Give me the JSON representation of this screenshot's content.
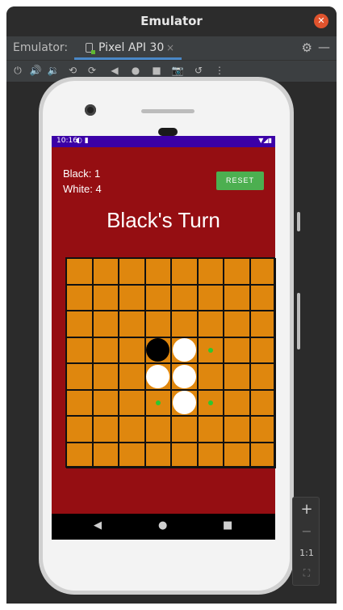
{
  "window": {
    "title": "Emulator"
  },
  "tabbar": {
    "prefix": "Emulator:",
    "tab_label": "Pixel API 30",
    "tab_close": "×"
  },
  "toolbar": {
    "icons": [
      "power-icon",
      "volume-up-icon",
      "volume-down-icon",
      "rotate-left-icon",
      "rotate-right-icon",
      "back-icon",
      "home-icon",
      "overview-icon",
      "camera-icon",
      "snapshot-icon",
      "more-icon"
    ]
  },
  "statusbar": {
    "time": "10:16"
  },
  "game": {
    "black_score": "Black: 1",
    "white_score": "White: 4",
    "reset_label": "RESET",
    "turn_text": "Black's Turn",
    "board_size": 8,
    "pieces": [
      {
        "row": 3,
        "col": 3,
        "color": "black"
      },
      {
        "row": 3,
        "col": 4,
        "color": "white"
      },
      {
        "row": 4,
        "col": 3,
        "color": "white"
      },
      {
        "row": 4,
        "col": 4,
        "color": "white"
      },
      {
        "row": 5,
        "col": 4,
        "color": "white"
      }
    ],
    "hints": [
      {
        "row": 3,
        "col": 5
      },
      {
        "row": 5,
        "col": 3
      },
      {
        "row": 5,
        "col": 5
      }
    ]
  },
  "zoom": {
    "plus": "+",
    "minus": "−",
    "one_to_one": "1:1"
  },
  "colors": {
    "app_background": "#950e12",
    "status_bar": "#3b00a7",
    "board": "#df870e",
    "reset_button": "#4caf50",
    "hint_dot": "#2ec72e"
  }
}
